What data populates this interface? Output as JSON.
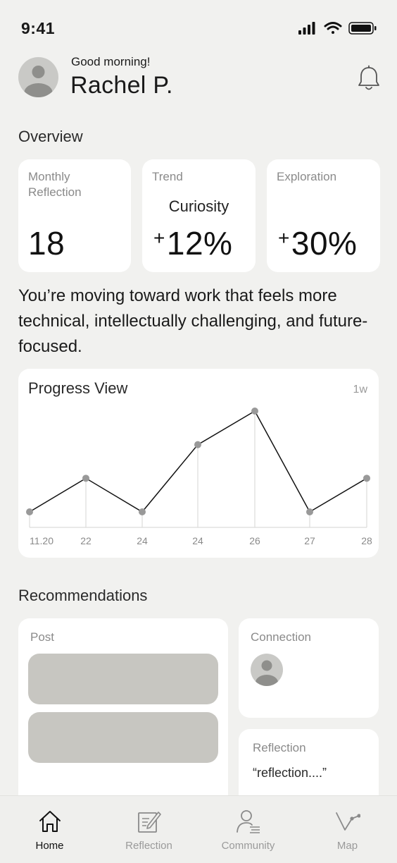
{
  "status_bar": {
    "time": "9:41"
  },
  "header": {
    "greeting": "Good morning!",
    "name": "Rachel P."
  },
  "overview": {
    "title": "Overview",
    "cards": [
      {
        "label": "Monthly\nReflection",
        "value": "18"
      },
      {
        "label": "Trend",
        "subtitle": "Curiosity",
        "sign": "+",
        "value": "12%"
      },
      {
        "label": "Exploration",
        "sign": "+",
        "value": "30%"
      }
    ]
  },
  "insight": "You’re moving toward work that feels more technical, intellectually challenging, and future-focused.",
  "progress": {
    "title": "Progress View",
    "range": "1w"
  },
  "chart_data": {
    "type": "line",
    "categories": [
      "11.20",
      "22",
      "24",
      "24",
      "26",
      "27",
      "28"
    ],
    "values": [
      1,
      2,
      1,
      3,
      4,
      1,
      2
    ],
    "title": "Progress View",
    "xlabel": "",
    "ylabel": "",
    "grid": false
  },
  "recommendations": {
    "title": "Recommendations",
    "post_label": "Post",
    "connection_label": "Connection",
    "reflection_label": "Reflection",
    "reflection_quote": "“reflection....”"
  },
  "tabs": [
    {
      "label": "Home",
      "icon": "home-icon",
      "active": true
    },
    {
      "label": "Reflection",
      "icon": "reflection-icon",
      "active": false
    },
    {
      "label": "Community",
      "icon": "community-icon",
      "active": false
    },
    {
      "label": "Map",
      "icon": "map-icon",
      "active": false
    }
  ],
  "colors": {
    "background": "#f1f1ef",
    "card": "#ffffff",
    "placeholder": "#c7c6c1",
    "point": "#999999",
    "inactive_tab": "#9a9a9a"
  }
}
